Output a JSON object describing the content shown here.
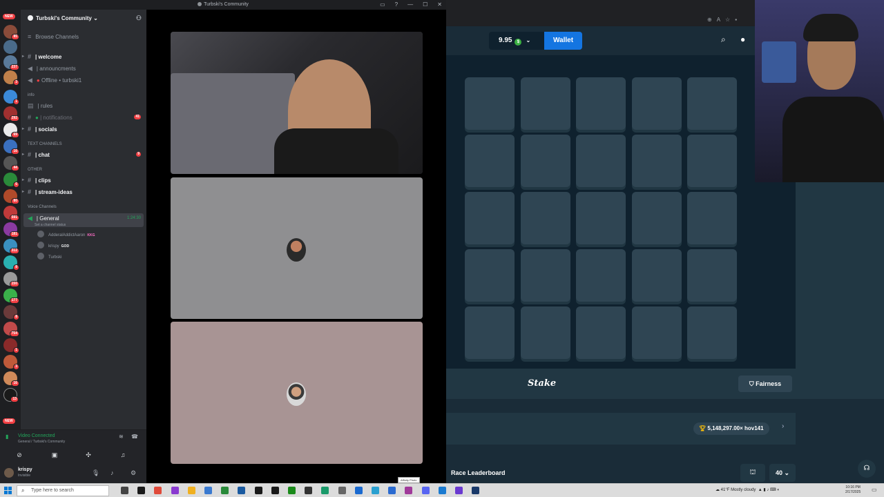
{
  "discord": {
    "window_title": "Turbski's Community",
    "window_controls": [
      "—",
      "☐",
      "✕"
    ],
    "guild_name": "Turbski's Community",
    "browse_channels": "Browse Channels",
    "channels": {
      "welcome": "| welcome",
      "announcements": "| announcments",
      "offline": "Offline • turbski1",
      "info_category": "info",
      "rules": "| rules",
      "notifications": "| notifications",
      "notifications_count": "41",
      "socials": "| socials",
      "text_category": "TEXT CHANNELS",
      "chat": "| chat",
      "chat_count": "9",
      "other_category": "OTHER",
      "clips": "| clips",
      "stream_ideas": "| stream-ideas",
      "voice_category": "Voice Channels",
      "general": "| General",
      "general_time": "1:24:30",
      "general_status": "Set a channel status"
    },
    "voice_members": [
      {
        "name": "AdderalAddictAaron",
        "tag": "KKG"
      },
      {
        "name": "krispy",
        "tag": "GOD"
      },
      {
        "name": "Turbski",
        "tag": ""
      }
    ],
    "server_pings": [
      "85",
      "237",
      "3",
      "1",
      "292",
      "69",
      "16",
      "44",
      "6",
      "80",
      "591",
      "181",
      "312",
      "8",
      "150",
      "177",
      "8",
      "754",
      "1",
      "3",
      "16",
      "13"
    ],
    "new_label": "NEW",
    "voice_connected": "Video Connected",
    "voice_location": "General / Turbski's Community",
    "user_name": "krispy",
    "user_status": "Invisible"
  },
  "stake": {
    "balance": "9.95",
    "wallet": "Wallet",
    "logo": "Stake",
    "fairness": "Fairness",
    "big_win": "5,148,297.00× hov141",
    "race_leaderboard": "Race Leaderboard",
    "bottom_value": "40"
  },
  "taskbar": {
    "search_placeholder": "Type here to search",
    "tooltip": "Affinity Photo",
    "weather": "41°F Mostly cloudy",
    "time": "10:16 PM",
    "date": "2/17/2025"
  }
}
